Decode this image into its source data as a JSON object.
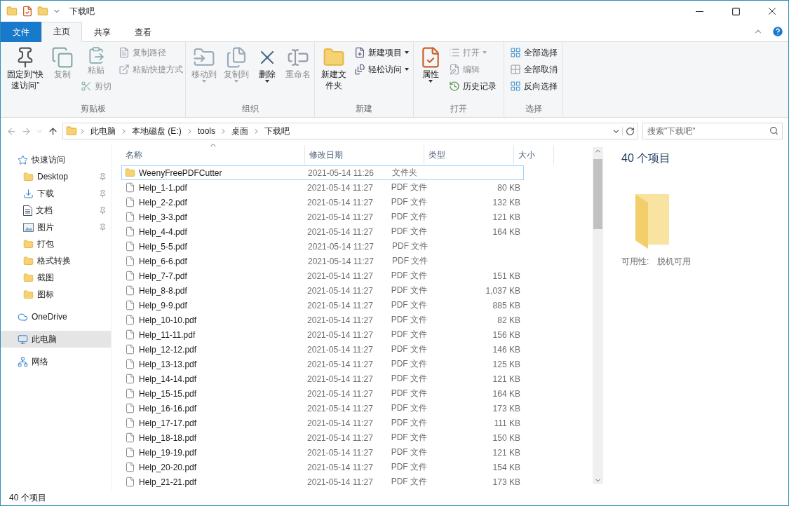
{
  "window": {
    "title": "下载吧"
  },
  "tabs": [
    {
      "label": "文件",
      "kind": "file",
      "selected": false
    },
    {
      "label": "主页",
      "kind": "tab",
      "selected": true
    },
    {
      "label": "共享",
      "kind": "tab",
      "selected": false
    },
    {
      "label": "查看",
      "kind": "tab",
      "selected": false
    }
  ],
  "ribbon": {
    "groups": [
      {
        "label": "剪贴板",
        "columns": [
          [
            {
              "label": "固定到“快速访问”",
              "kind": "large",
              "disabled": false,
              "dropdown": false
            }
          ],
          [
            {
              "label": "复制",
              "kind": "large",
              "disabled": true,
              "dropdown": false
            }
          ],
          [
            {
              "label": "粘贴",
              "kind": "medium",
              "disabled": true,
              "dropdown": false
            },
            {
              "label": "剪切",
              "kind": "small",
              "disabled": true,
              "dropdown": false
            }
          ],
          [
            {
              "label": "复制路径",
              "kind": "small",
              "disabled": true,
              "dropdown": false
            },
            {
              "label": "粘贴快捷方式",
              "kind": "small",
              "disabled": true,
              "dropdown": false
            }
          ]
        ]
      },
      {
        "label": "组织",
        "columns": [
          [
            {
              "label": "移动到",
              "kind": "large",
              "disabled": true,
              "dropdown": true
            }
          ],
          [
            {
              "label": "复制到",
              "kind": "large",
              "disabled": true,
              "dropdown": true
            }
          ],
          [
            {
              "label": "删除",
              "kind": "large",
              "disabled": false,
              "dropdown": true
            }
          ],
          [
            {
              "label": "重命名",
              "kind": "large",
              "disabled": true,
              "dropdown": false
            }
          ]
        ]
      },
      {
        "label": "新建",
        "columns": [
          [
            {
              "label": "新建文件夹",
              "kind": "large",
              "disabled": false,
              "dropdown": false
            }
          ],
          [
            {
              "label": "新建项目",
              "kind": "small",
              "disabled": false,
              "dropdown": true
            },
            {
              "label": "轻松访问",
              "kind": "small",
              "disabled": false,
              "dropdown": true
            }
          ]
        ]
      },
      {
        "label": "打开",
        "columns": [
          [
            {
              "label": "属性",
              "kind": "large",
              "disabled": false,
              "dropdown": true
            }
          ],
          [
            {
              "label": "打开",
              "kind": "small",
              "disabled": true,
              "dropdown": true
            },
            {
              "label": "编辑",
              "kind": "small",
              "disabled": true,
              "dropdown": false
            },
            {
              "label": "历史记录",
              "kind": "small",
              "disabled": false,
              "dropdown": false
            }
          ]
        ]
      },
      {
        "label": "选择",
        "columns": [
          [
            {
              "label": "全部选择",
              "kind": "small",
              "disabled": false,
              "dropdown": false
            },
            {
              "label": "全部取消",
              "kind": "small",
              "disabled": false,
              "dropdown": false
            },
            {
              "label": "反向选择",
              "kind": "small",
              "disabled": false,
              "dropdown": false
            }
          ]
        ]
      }
    ]
  },
  "address_bar": {
    "path": [
      "此电脑",
      "本地磁盘 (E:)",
      "tools",
      "桌面",
      "下载吧"
    ],
    "search": {
      "placeholder": "搜索\"下载吧\""
    }
  },
  "navigation": [
    {
      "label": "快速访问",
      "kind": "star",
      "selected": false,
      "children": [
        {
          "label": "Desktop",
          "kind": "folder",
          "pinned": true,
          "selected": false
        },
        {
          "label": "下载",
          "kind": "download",
          "pinned": true,
          "selected": false
        },
        {
          "label": "文档",
          "kind": "document",
          "pinned": true,
          "selected": false
        },
        {
          "label": "图片",
          "kind": "picture",
          "pinned": true,
          "selected": false
        },
        {
          "label": "打包",
          "kind": "folder",
          "pinned": false,
          "selected": false
        },
        {
          "label": "格式转换",
          "kind": "folder",
          "pinned": false,
          "selected": false
        },
        {
          "label": "截图",
          "kind": "folder",
          "pinned": false,
          "selected": false
        },
        {
          "label": "图标",
          "kind": "folder",
          "pinned": false,
          "selected": false
        }
      ]
    },
    {
      "label": "OneDrive",
      "kind": "cloud",
      "selected": false
    },
    {
      "label": "此电脑",
      "kind": "pc",
      "selected": true
    },
    {
      "label": "网络",
      "kind": "network",
      "selected": false
    }
  ],
  "file_list": {
    "columns": [
      {
        "label": "名称",
        "sorted": true
      },
      {
        "label": "修改日期",
        "sorted": false
      },
      {
        "label": "类型",
        "sorted": false
      },
      {
        "label": "大小",
        "sorted": false
      }
    ],
    "rows": [
      {
        "name": "WeenyFreePDFCutter",
        "kind": "folder",
        "date": "2021-05-14 11:26",
        "type": "文件夹",
        "focused": true
      },
      {
        "name": "Help_1-1.pdf",
        "kind": "pdf",
        "date": "2021-05-14 11:27",
        "type": "PDF 文件",
        "size": "80 KB",
        "focused": false
      },
      {
        "name": "Help_2-2.pdf",
        "kind": "pdf",
        "date": "2021-05-14 11:27",
        "type": "PDF 文件",
        "size": "132 KB",
        "focused": false
      },
      {
        "name": "Help_3-3.pdf",
        "kind": "pdf",
        "date": "2021-05-14 11:27",
        "type": "PDF 文件",
        "size": "121 KB",
        "focused": false
      },
      {
        "name": "Help_4-4.pdf",
        "kind": "pdf",
        "date": "2021-05-14 11:27",
        "type": "PDF 文件",
        "size": "164 KB",
        "focused": false
      },
      {
        "name": "Help_5-5.pdf",
        "kind": "pdf",
        "date": "2021-05-14 11:27",
        "type": "PDF 文件",
        "focused": false
      },
      {
        "name": "Help_6-6.pdf",
        "kind": "pdf",
        "date": "2021-05-14 11:27",
        "type": "PDF 文件",
        "focused": false
      },
      {
        "name": "Help_7-7.pdf",
        "kind": "pdf",
        "date": "2021-05-14 11:27",
        "type": "PDF 文件",
        "size": "151 KB",
        "focused": false
      },
      {
        "name": "Help_8-8.pdf",
        "kind": "pdf",
        "date": "2021-05-14 11:27",
        "type": "PDF 文件",
        "size": "1,037 KB",
        "focused": false
      },
      {
        "name": "Help_9-9.pdf",
        "kind": "pdf",
        "date": "2021-05-14 11:27",
        "type": "PDF 文件",
        "size": "885 KB",
        "focused": false
      },
      {
        "name": "Help_10-10.pdf",
        "kind": "pdf",
        "date": "2021-05-14 11:27",
        "type": "PDF 文件",
        "size": "82 KB",
        "focused": false
      },
      {
        "name": "Help_11-11.pdf",
        "kind": "pdf",
        "date": "2021-05-14 11:27",
        "type": "PDF 文件",
        "size": "156 KB",
        "focused": false
      },
      {
        "name": "Help_12-12.pdf",
        "kind": "pdf",
        "date": "2021-05-14 11:27",
        "type": "PDF 文件",
        "size": "146 KB",
        "focused": false
      },
      {
        "name": "Help_13-13.pdf",
        "kind": "pdf",
        "date": "2021-05-14 11:27",
        "type": "PDF 文件",
        "size": "125 KB",
        "focused": false
      },
      {
        "name": "Help_14-14.pdf",
        "kind": "pdf",
        "date": "2021-05-14 11:27",
        "type": "PDF 文件",
        "size": "121 KB",
        "focused": false
      },
      {
        "name": "Help_15-15.pdf",
        "kind": "pdf",
        "date": "2021-05-14 11:27",
        "type": "PDF 文件",
        "size": "164 KB",
        "focused": false
      },
      {
        "name": "Help_16-16.pdf",
        "kind": "pdf",
        "date": "2021-05-14 11:27",
        "type": "PDF 文件",
        "size": "173 KB",
        "focused": false
      },
      {
        "name": "Help_17-17.pdf",
        "kind": "pdf",
        "date": "2021-05-14 11:27",
        "type": "PDF 文件",
        "size": "111 KB",
        "focused": false
      },
      {
        "name": "Help_18-18.pdf",
        "kind": "pdf",
        "date": "2021-05-14 11:27",
        "type": "PDF 文件",
        "size": "150 KB",
        "focused": false
      },
      {
        "name": "Help_19-19.pdf",
        "kind": "pdf",
        "date": "2021-05-14 11:27",
        "type": "PDF 文件",
        "size": "121 KB",
        "focused": false
      },
      {
        "name": "Help_20-20.pdf",
        "kind": "pdf",
        "date": "2021-05-14 11:27",
        "type": "PDF 文件",
        "size": "154 KB",
        "focused": false
      },
      {
        "name": "Help_21-21.pdf",
        "kind": "pdf",
        "date": "2021-05-14 11:27",
        "type": "PDF 文件",
        "size": "173 KB",
        "focused": false
      }
    ]
  },
  "details_pane": {
    "count": "40 个项目",
    "availability_label": "可用性:",
    "availability_value": "脱机可用"
  },
  "status_bar": {
    "text": "40 个项目"
  }
}
